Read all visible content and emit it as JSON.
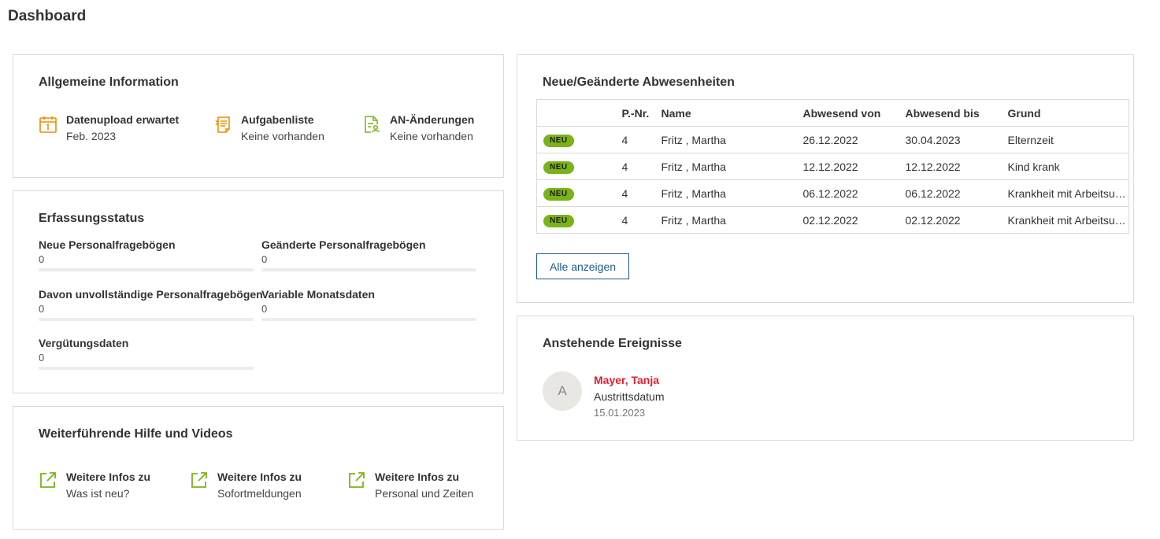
{
  "page": {
    "title": "Dashboard"
  },
  "colors": {
    "accent_orange": "#f08a00",
    "accent_green": "#7ab317",
    "link_blue": "#1c5a8a",
    "event_red": "#e0202e"
  },
  "info": {
    "title": "Allgemeine Information",
    "items": [
      {
        "icon": "calendar-icon",
        "label": "Datenupload erwartet",
        "value": "Feb. 2023"
      },
      {
        "icon": "tasklist-icon",
        "label": "Aufgabenliste",
        "value": "Keine vorhanden"
      },
      {
        "icon": "document-person-icon",
        "label": "AN-Änderungen",
        "value": "Keine vorhanden"
      }
    ]
  },
  "status": {
    "title": "Erfassungsstatus",
    "items": [
      {
        "label": "Neue Personalfragebögen",
        "value": "0"
      },
      {
        "label": "Geänderte Personalfragebögen",
        "value": "0"
      },
      {
        "label": "Davon unvollständige Personalfragebögen",
        "value": "0"
      },
      {
        "label": "Variable Monatsdaten",
        "value": "0"
      },
      {
        "label": "Vergütungsdaten",
        "value": "0"
      }
    ]
  },
  "help": {
    "title": "Weiterführende Hilfe und Videos",
    "items": [
      {
        "icon": "external-link-icon",
        "label": "Weitere Infos zu",
        "value": "Was ist neu?"
      },
      {
        "icon": "external-link-icon",
        "label": "Weitere Infos zu",
        "value": "Sofortmeldungen"
      },
      {
        "icon": "external-link-icon",
        "label": "Weitere Infos zu",
        "value": "Personal und Zeiten"
      }
    ]
  },
  "absences": {
    "title": "Neue/Geänderte Abwesenheiten",
    "columns": [
      "",
      "P.-Nr.",
      "Name",
      "Abwesend von",
      "Abwesend bis",
      "Grund"
    ],
    "rows": [
      {
        "badge": "NEU",
        "pnr": "4",
        "name": "Fritz , Martha",
        "from": "26.12.2022",
        "to": "30.04.2023",
        "reason": "Elternzeit"
      },
      {
        "badge": "NEU",
        "pnr": "4",
        "name": "Fritz , Martha",
        "from": "12.12.2022",
        "to": "12.12.2022",
        "reason": "Kind krank"
      },
      {
        "badge": "NEU",
        "pnr": "4",
        "name": "Fritz , Martha",
        "from": "06.12.2022",
        "to": "06.12.2022",
        "reason": "Krankheit mit Arbeitsunfähigkeit"
      },
      {
        "badge": "NEU",
        "pnr": "4",
        "name": "Fritz , Martha",
        "from": "02.12.2022",
        "to": "02.12.2022",
        "reason": "Krankheit mit Arbeitsunfähigkeit"
      }
    ],
    "button": "Alle anzeigen"
  },
  "events": {
    "title": "Anstehende Ereignisse",
    "items": [
      {
        "initial": "A",
        "name": "Mayer, Tanja",
        "type": "Austrittsdatum",
        "date": "15.01.2023"
      }
    ]
  }
}
